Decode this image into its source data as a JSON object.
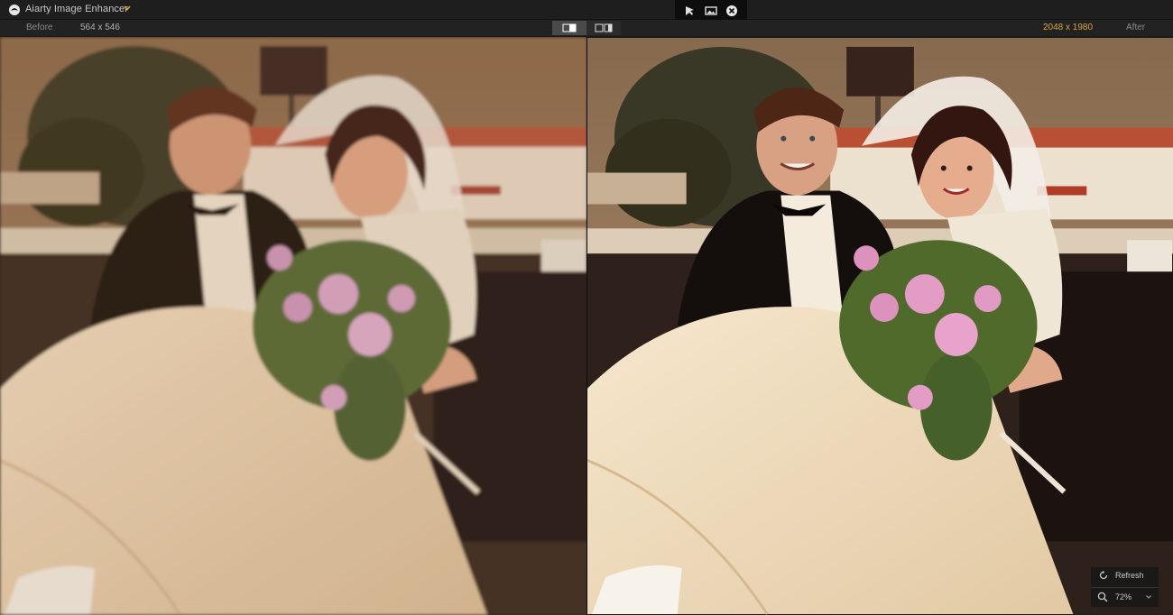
{
  "app": {
    "title": "Aiarty Image Enhancer",
    "accent_color": "#d7a43e"
  },
  "titlebar": {
    "icons": [
      "app-logo-icon",
      "chevron-down-icon"
    ],
    "tools": [
      "compare-cursor-icon",
      "image-view-icon",
      "close-icon"
    ]
  },
  "infobar": {
    "before_label": "Before",
    "before_size": "564 x 546",
    "after_size": "2048 x 1980",
    "after_label": "After",
    "view_modes": [
      "side-by-side-icon",
      "split-view-icon"
    ]
  },
  "preview": {
    "before": {
      "description_icon": "original-photo"
    },
    "after": {
      "description_icon": "enhanced-photo"
    }
  },
  "controls": {
    "refresh_label": "Refresh",
    "zoom_value": "72%"
  }
}
